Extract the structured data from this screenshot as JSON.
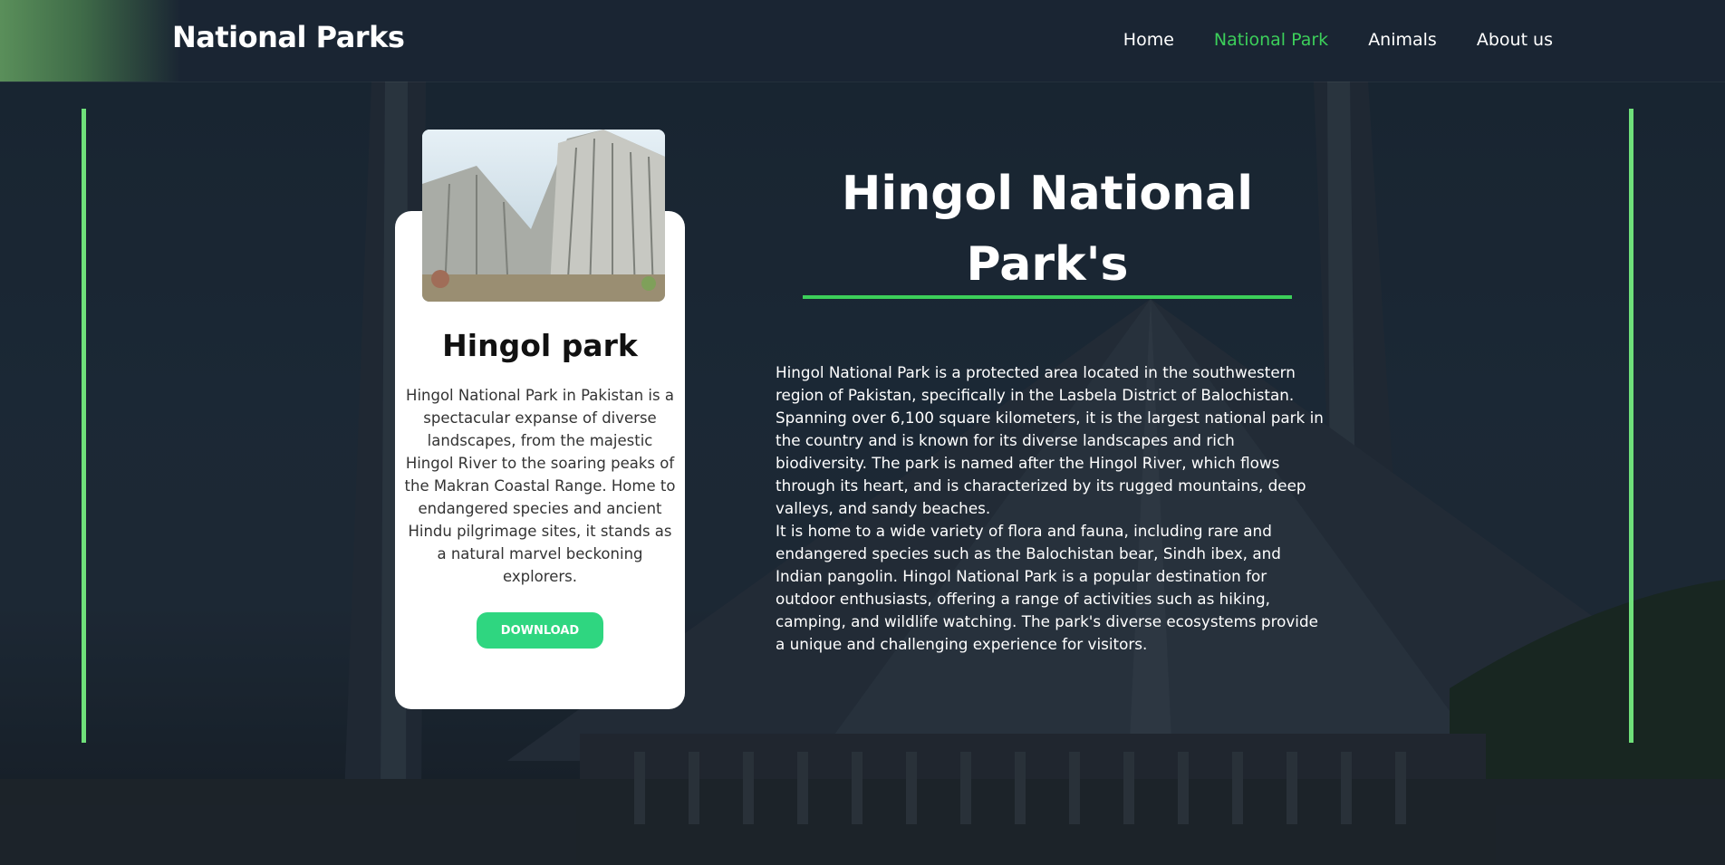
{
  "navbar": {
    "brand": "National Parks",
    "links": [
      {
        "label": "Home",
        "active": false
      },
      {
        "label": "National Park",
        "active": true
      },
      {
        "label": "Animals",
        "active": false
      },
      {
        "label": "About us",
        "active": false
      }
    ]
  },
  "card": {
    "title": "Hingol park",
    "description": "Hingol National Park in Pakistan is a spectacular expanse of diverse landscapes, from the majestic Hingol River to the soaring peaks of the Makran Coastal Range. Home to endangered species and ancient Hindu pilgrimage sites, it stands as a natural marvel beckoning explorers.",
    "button_label": "DOWNLOAD"
  },
  "main": {
    "heading": "Hingol National Park's",
    "paragraphs": [
      "Hingol National Park is a protected area located in the southwestern region of Pakistan, specifically in the Lasbela District of Balochistan. Spanning over 6,100 square kilometers, it is the largest national park in the country and is known for its diverse landscapes and rich biodiversity. The park is named after the Hingol River, which flows through its heart, and is characterized by its rugged mountains, deep valleys, and sandy beaches.",
      "It is home to a wide variety of flora and fauna, including rare and endangered species such as the Balochistan bear, Sindh ibex, and Indian pangolin. Hingol National Park is a popular destination for outdoor enthusiasts, offering a range of activities such as hiking, camping, and wildlife watching. The park's diverse ecosystems provide a unique and challenging experience for visitors."
    ]
  },
  "colors": {
    "accent_green": "#3ccf5a",
    "bar_green": "#6fe07a",
    "button_green": "#2fd680",
    "navbar_bg": "#1a2533"
  }
}
